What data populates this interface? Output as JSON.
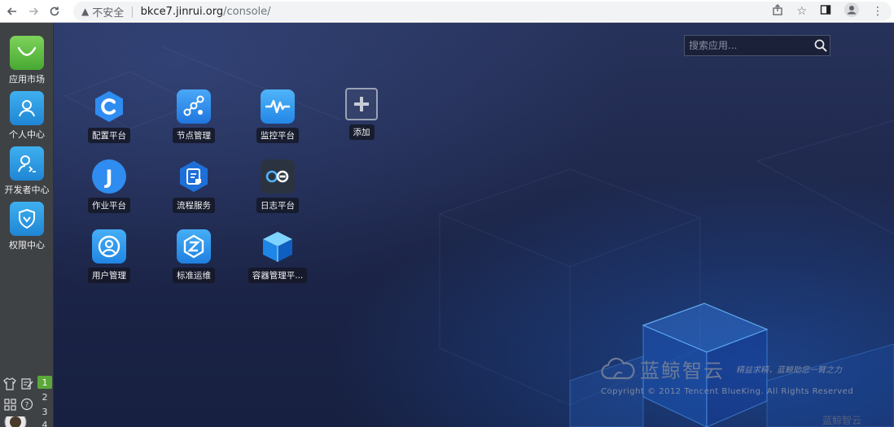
{
  "browser": {
    "security_label": "不安全",
    "url_host": "bkce7.jinrui.org",
    "url_path": "/console/"
  },
  "dock": {
    "items": [
      {
        "label": "应用市场",
        "icon": "shopping-bag-icon",
        "color": "#5bbd3a"
      },
      {
        "label": "个人中心",
        "icon": "user-icon",
        "color": "#2e9be0"
      },
      {
        "label": "开发者中心",
        "icon": "developer-icon",
        "color": "#2e9be0"
      },
      {
        "label": "权限中心",
        "icon": "shield-icon",
        "color": "#2e9be0"
      }
    ],
    "pages": [
      "1",
      "2",
      "3",
      "4"
    ]
  },
  "search": {
    "placeholder": "搜索应用..."
  },
  "apps": [
    {
      "label": "配置平台",
      "icon": "config-platform-icon"
    },
    {
      "label": "节点管理",
      "icon": "node-management-icon"
    },
    {
      "label": "监控平台",
      "icon": "monitor-platform-icon"
    },
    {
      "label": "添加",
      "icon": "add-icon"
    },
    {
      "label": "作业平台",
      "icon": "job-platform-icon"
    },
    {
      "label": "流程服务",
      "icon": "process-service-icon"
    },
    {
      "label": "日志平台",
      "icon": "log-platform-icon"
    },
    {
      "label": "用户管理",
      "icon": "user-management-icon"
    },
    {
      "label": "标准运维",
      "icon": "standard-ops-icon"
    },
    {
      "label": "容器管理平...",
      "icon": "container-platform-icon"
    }
  ],
  "brand": {
    "name": "蓝鲸智云",
    "slogan": "精益求精，蓝鲸助您一臂之力",
    "copyright": "Copyright © 2012 Tencent BlueKing. All Rights Reserved",
    "corner": "蓝鲸智云"
  }
}
